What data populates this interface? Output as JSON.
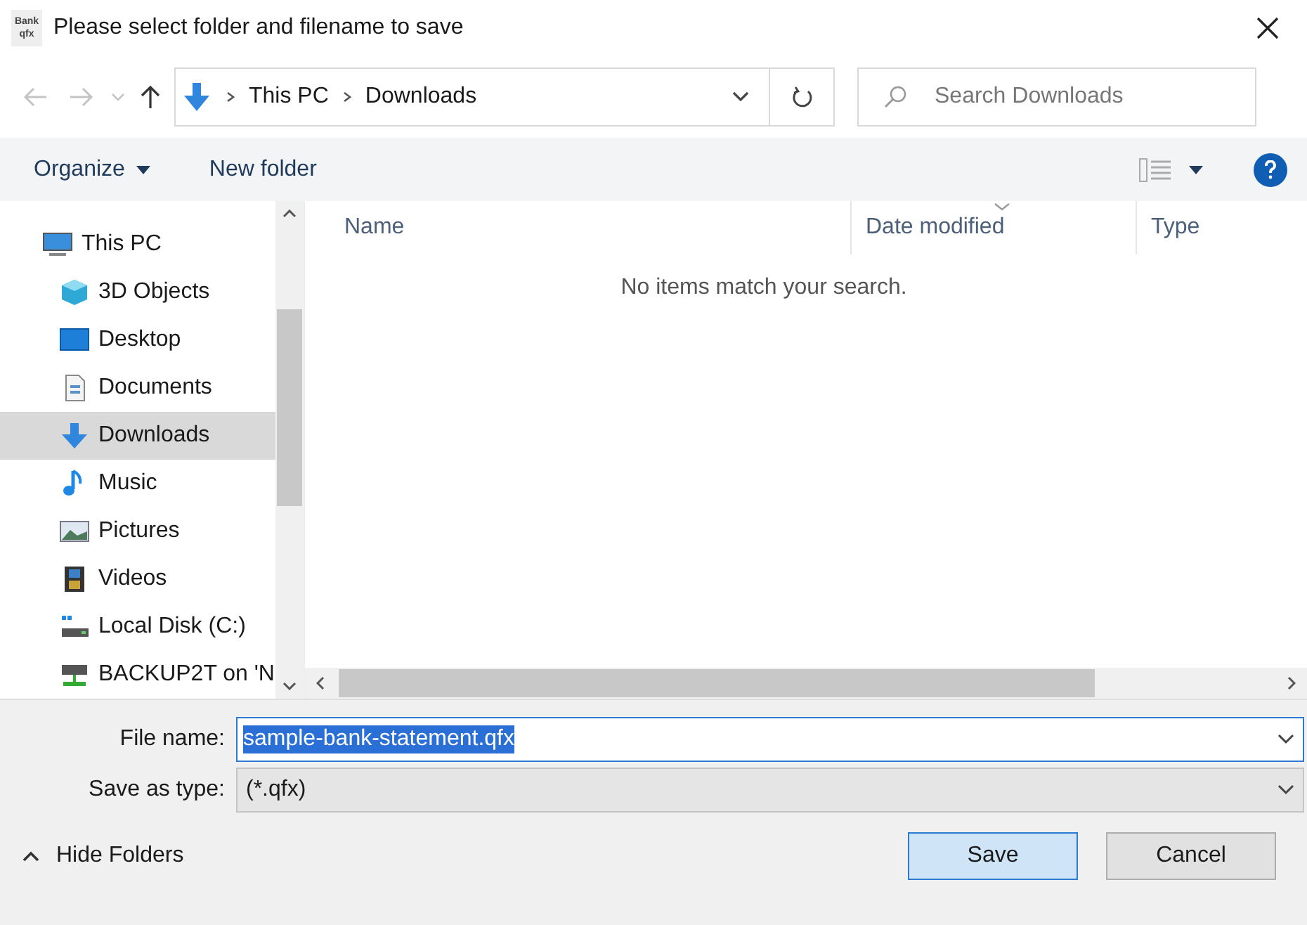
{
  "window": {
    "title": "Please select folder and filename to save",
    "app_icon": [
      "Bank",
      "qfx"
    ]
  },
  "address_bar": {
    "path": [
      "This PC",
      "Downloads"
    ]
  },
  "search": {
    "placeholder": "Search Downloads"
  },
  "toolbar": {
    "organize": "Organize",
    "new_folder": "New folder"
  },
  "tree": [
    {
      "label": "This PC",
      "kind": "pc",
      "selected": false,
      "children": [
        {
          "label": "3D Objects",
          "kind": "cube",
          "selected": false
        },
        {
          "label": "Desktop",
          "kind": "desktop",
          "selected": false
        },
        {
          "label": "Documents",
          "kind": "documents",
          "selected": false
        },
        {
          "label": "Downloads",
          "kind": "downloads",
          "selected": true
        },
        {
          "label": "Music",
          "kind": "music",
          "selected": false
        },
        {
          "label": "Pictures",
          "kind": "pictures",
          "selected": false
        },
        {
          "label": "Videos",
          "kind": "videos",
          "selected": false
        },
        {
          "label": "Local Disk (C:)",
          "kind": "disk",
          "selected": false
        },
        {
          "label": "BACKUP2T on 'N",
          "kind": "network",
          "selected": false
        }
      ]
    }
  ],
  "table": {
    "columns": [
      {
        "label": "Name",
        "sorted": false
      },
      {
        "label": "Date modified",
        "sorted": true
      },
      {
        "label": "Type",
        "sorted": false
      }
    ],
    "empty_message": "No items match your search."
  },
  "form": {
    "file_name_label": "File name:",
    "file_name": "sample-bank-statement.qfx",
    "type_label": "Save as type:",
    "type": "(*.qfx)"
  },
  "hide_folders": "Hide Folders",
  "buttons": [
    {
      "label": "Save",
      "kind": "primary"
    },
    {
      "label": "Cancel",
      "kind": "secondary"
    }
  ]
}
